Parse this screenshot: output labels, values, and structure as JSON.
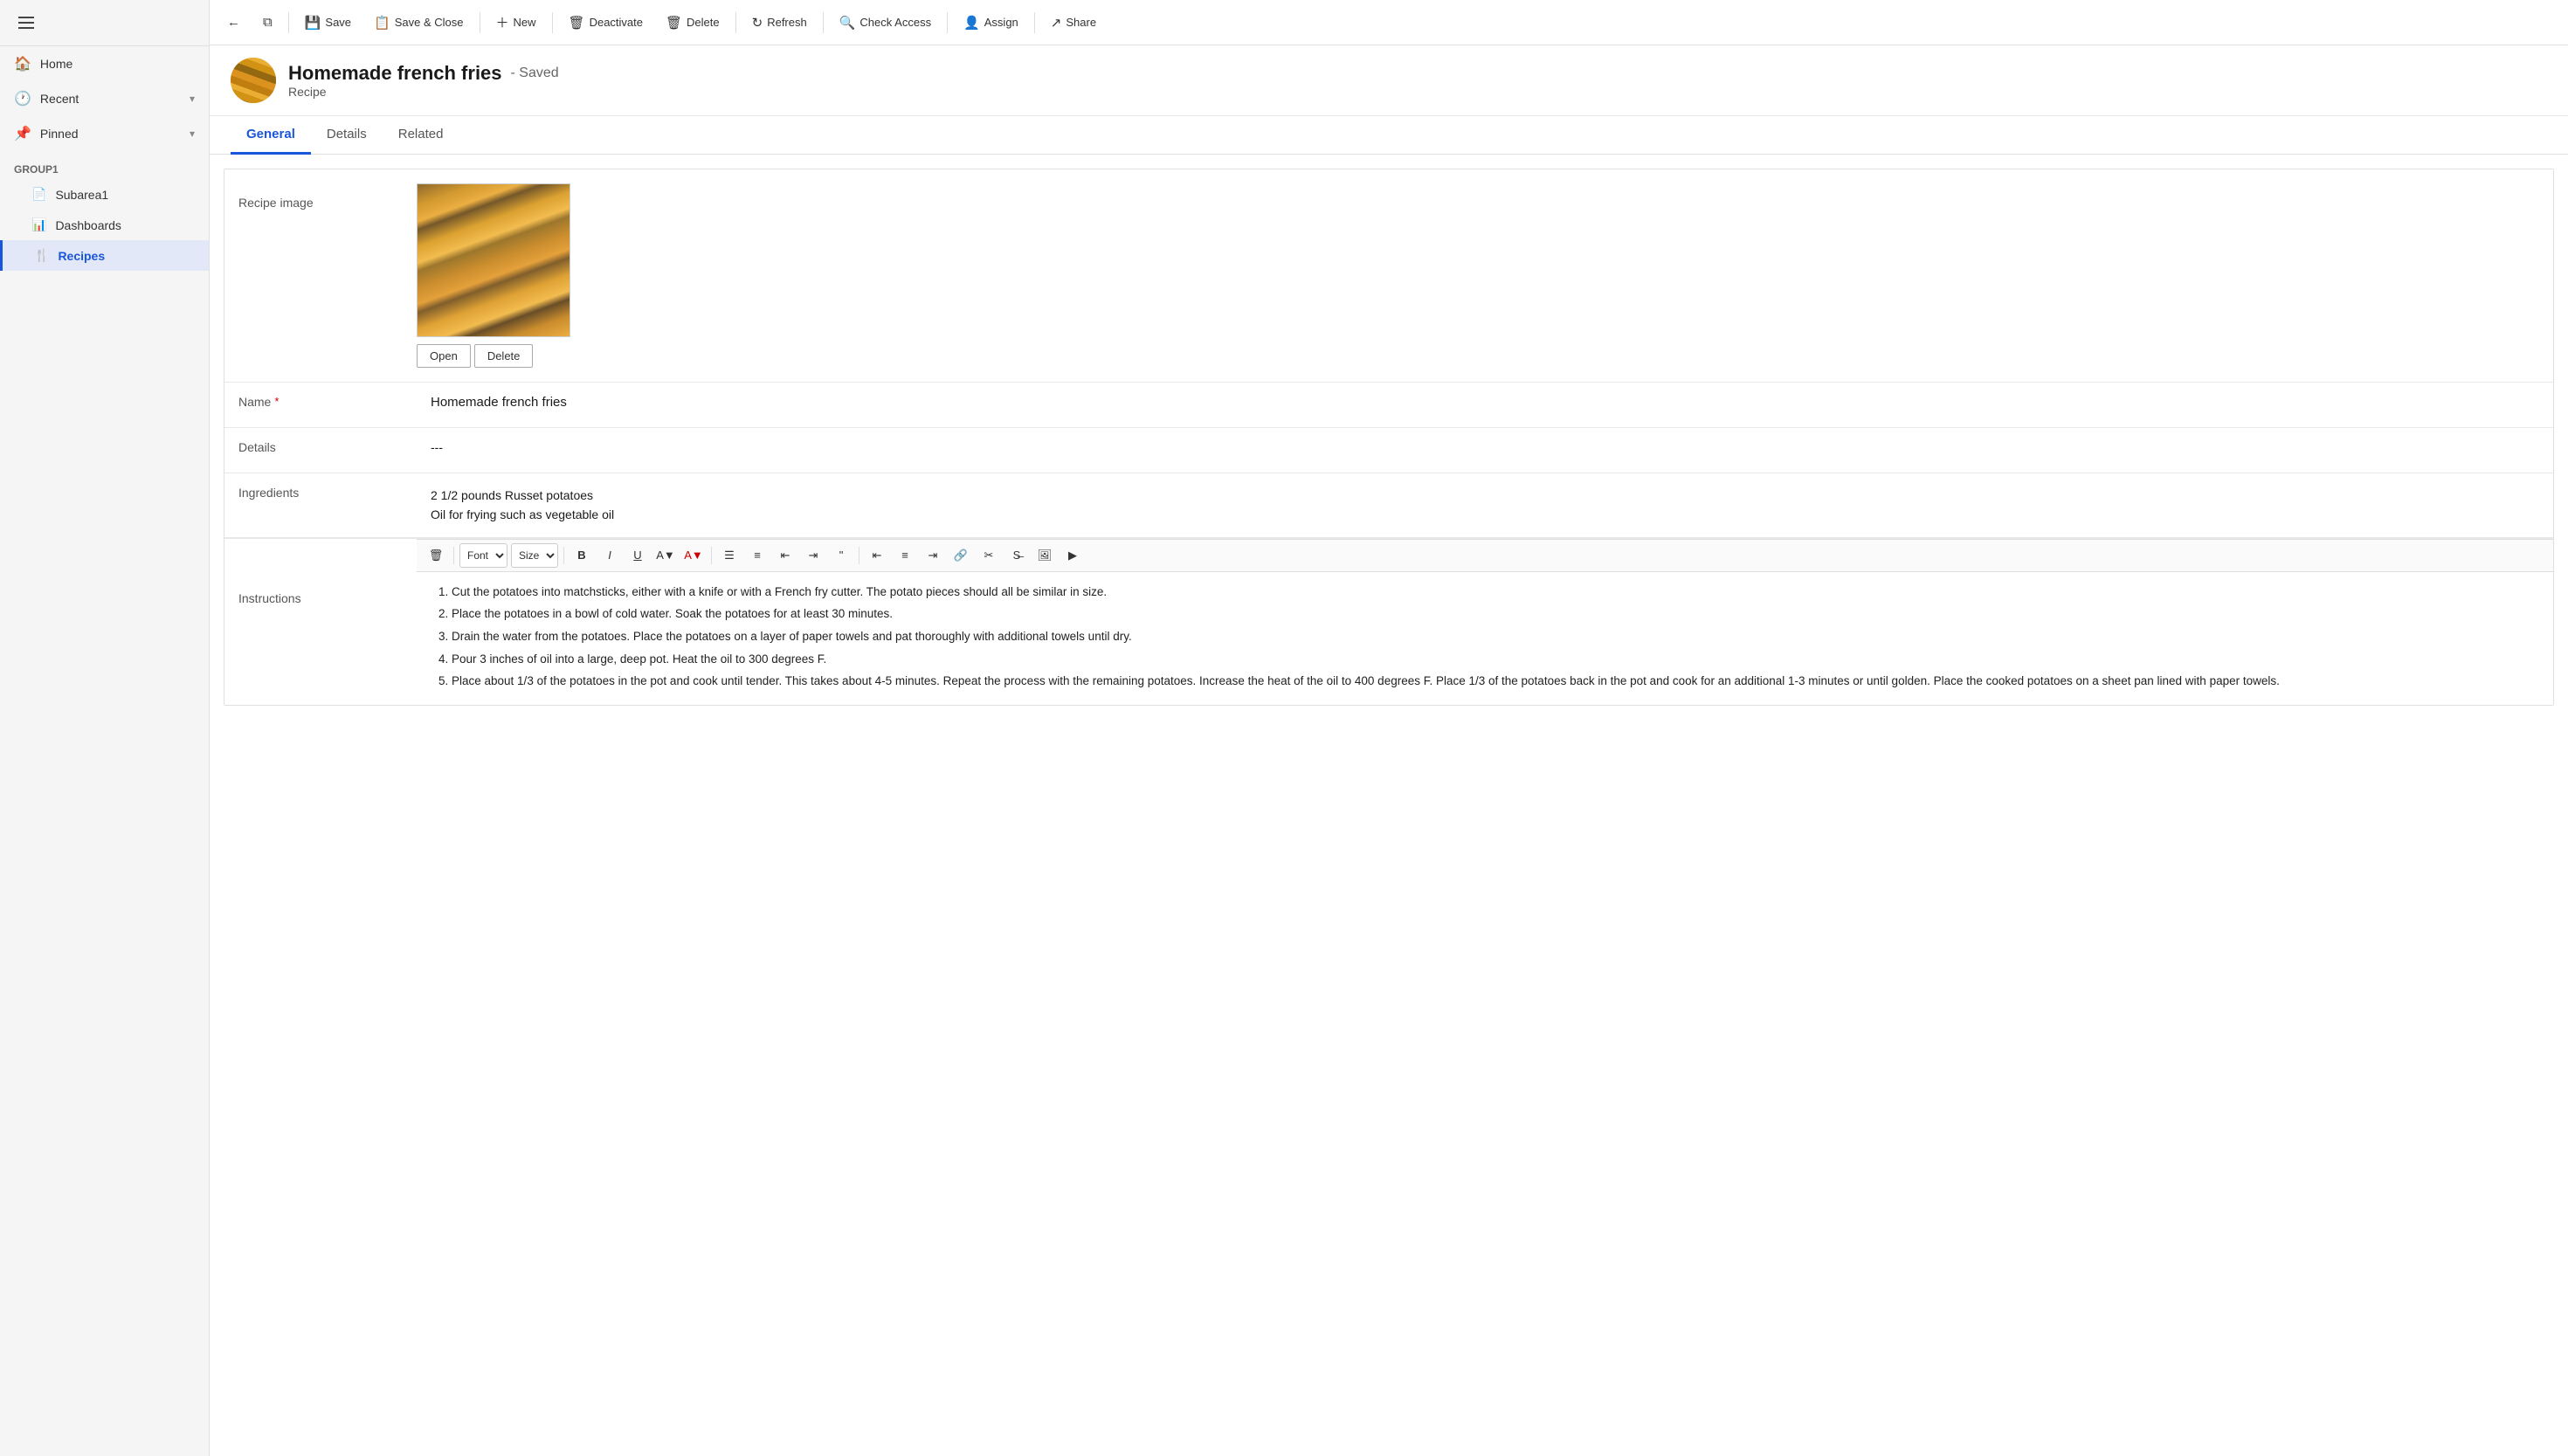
{
  "sidebar": {
    "nav_items": [
      {
        "id": "home",
        "label": "Home",
        "icon": "🏠"
      },
      {
        "id": "recent",
        "label": "Recent",
        "icon": "🕐",
        "expandable": true
      },
      {
        "id": "pinned",
        "label": "Pinned",
        "icon": "📌",
        "expandable": true
      }
    ],
    "group_label": "Group1",
    "sub_items": [
      {
        "id": "subarea1",
        "label": "Subarea1",
        "icon": "📄"
      },
      {
        "id": "dashboards",
        "label": "Dashboards",
        "icon": "📊"
      },
      {
        "id": "recipes",
        "label": "Recipes",
        "icon": "🍴",
        "active": true
      }
    ]
  },
  "toolbar": {
    "back_label": "",
    "open_label": "",
    "save_label": "Save",
    "save_close_label": "Save & Close",
    "new_label": "New",
    "deactivate_label": "Deactivate",
    "delete_label": "Delete",
    "refresh_label": "Refresh",
    "check_access_label": "Check Access",
    "assign_label": "Assign",
    "share_label": "Share"
  },
  "record": {
    "title": "Homemade french fries",
    "saved_status": "- Saved",
    "type": "Recipe"
  },
  "tabs": [
    {
      "id": "general",
      "label": "General",
      "active": true
    },
    {
      "id": "details",
      "label": "Details"
    },
    {
      "id": "related",
      "label": "Related"
    }
  ],
  "form": {
    "image_label": "Recipe image",
    "image_open_btn": "Open",
    "image_delete_btn": "Delete",
    "name_label": "Name",
    "name_value": "Homemade french fries",
    "details_label": "Details",
    "details_value": "---",
    "ingredients_label": "Ingredients",
    "ingredients_line1": "2 1/2 pounds Russet potatoes",
    "ingredients_line2": "Oil for frying such as vegetable oil",
    "instructions_label": "Instructions",
    "instructions": [
      "Cut the potatoes into matchsticks, either with a knife or with a French fry cutter. The potato pieces should all be similar in size.",
      "Place the potatoes in a bowl of cold water. Soak the potatoes for at least 30 minutes.",
      "Drain the water from the potatoes. Place the potatoes on a layer of paper towels and pat thoroughly with additional towels until dry.",
      "Pour 3 inches of oil into a large, deep pot. Heat the oil to 300 degrees F.",
      "Place about 1/3 of the potatoes in the pot and cook until tender. This takes about 4-5 minutes. Repeat the process with the remaining potatoes. Increase the heat of the oil to 400 degrees F. Place 1/3 of the potatoes back in the pot and cook for an additional 1-3 minutes or until golden. Place the cooked potatoes on a sheet pan lined with paper towels."
    ]
  },
  "rte": {
    "font_label": "Font",
    "size_label": "Size"
  }
}
